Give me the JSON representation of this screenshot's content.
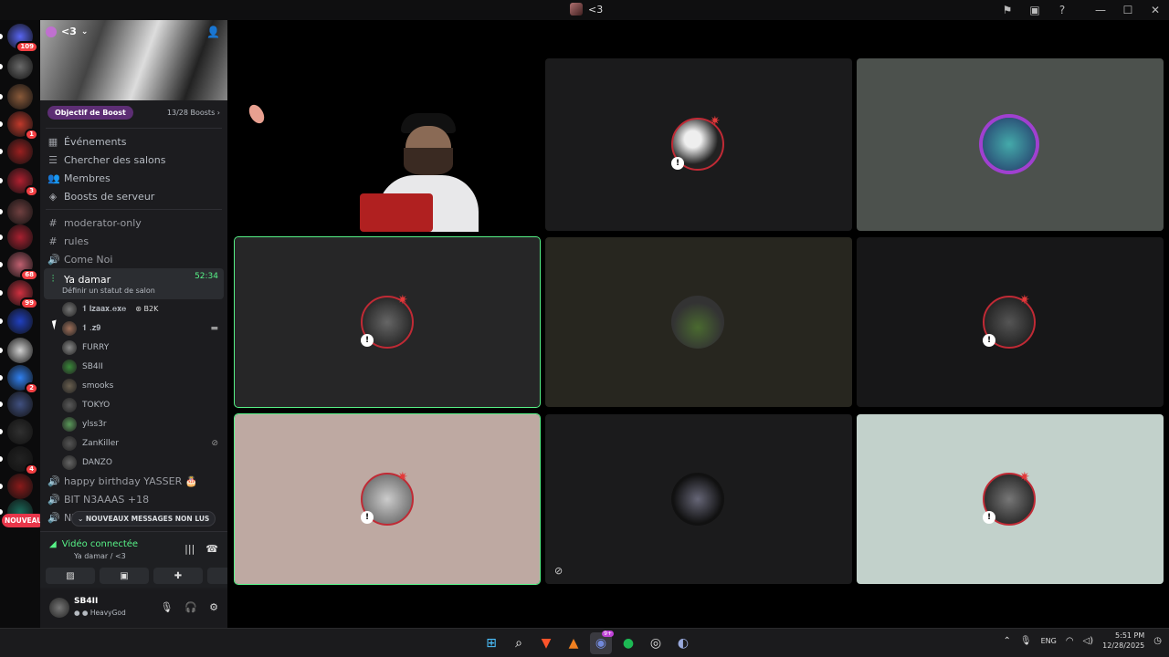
{
  "window": {
    "title": "<3"
  },
  "title_icons": [
    "inbox-icon",
    "screen-icon",
    "help-icon",
    "minimize-icon",
    "maximize-icon",
    "close-icon"
  ],
  "guilds": [
    {
      "name": "discord-home",
      "badge": "109",
      "color": "#5865f2"
    },
    {
      "name": "guild-1",
      "badge": "",
      "color": "#6a6a6a"
    },
    {
      "name": "guild-2",
      "badge": "",
      "color": "#8a5a3a"
    },
    {
      "name": "guild-3",
      "badge": "1",
      "color": "#c0392b"
    },
    {
      "name": "guild-4",
      "badge": "",
      "color": "#9a2020"
    },
    {
      "name": "guild-5",
      "badge": "3",
      "color": "#b02030"
    },
    {
      "name": "guild-6",
      "badge": "",
      "color": "#704040"
    },
    {
      "name": "guild-7",
      "badge": "",
      "color": "#a82030"
    },
    {
      "name": "guild-8",
      "badge": "68",
      "color": "#c06070"
    },
    {
      "name": "guild-9",
      "badge": "99",
      "color": "#d03040"
    },
    {
      "name": "guild-10",
      "badge": "",
      "color": "#2040c0"
    },
    {
      "name": "guild-11",
      "badge": "",
      "color": "#d0d0d0"
    },
    {
      "name": "guild-12",
      "badge": "2",
      "color": "#3080f0"
    },
    {
      "name": "guild-13",
      "badge": "",
      "color": "#405080"
    },
    {
      "name": "guild-14",
      "badge": "",
      "color": "#303030"
    },
    {
      "name": "guild-15",
      "badge": "4",
      "color": "#222"
    },
    {
      "name": "guild-16",
      "badge": "",
      "color": "#8a1a1a"
    },
    {
      "name": "guild-17",
      "badge": "",
      "color": "#1a6a5a"
    }
  ],
  "nouveau_label": "NOUVEAU",
  "server": {
    "name": "<3",
    "boost_goal": "Objectif de Boost",
    "boost_count": "13/28 Boosts",
    "nav": [
      {
        "label": "Événements",
        "icon": "calendar-icon",
        "glyph": "▦"
      },
      {
        "label": "Chercher des salons",
        "icon": "channel-browse-icon",
        "glyph": "☰"
      },
      {
        "label": "Membres",
        "icon": "members-icon",
        "glyph": "👥"
      },
      {
        "label": "Boosts de serveur",
        "icon": "boost-icon",
        "glyph": "◈"
      }
    ],
    "channels": [
      {
        "label": "moderator-only",
        "glyph": "#"
      },
      {
        "label": "rules",
        "glyph": "#"
      },
      {
        "label": "Come Noi",
        "glyph": "🔊"
      }
    ],
    "active_channel": {
      "label": "Ya damar",
      "timer": "52:34",
      "status": "Définir un statut de salon"
    },
    "voice_users": [
      {
        "name": "𝟏 𝐥𝐳𝐚𝐚𝐱.𝐞𝐱𝐞",
        "tag": "B2K",
        "right": ""
      },
      {
        "name": "𝟏 .𝐳𝟗",
        "tag": "",
        "right": "▬"
      },
      {
        "name": "FURRY",
        "tag": "",
        "right": ""
      },
      {
        "name": "SB4II",
        "tag": "",
        "right": ""
      },
      {
        "name": "smooks",
        "tag": "",
        "right": ""
      },
      {
        "name": "TOKYO",
        "tag": "",
        "right": ""
      },
      {
        "name": "ylss3r",
        "tag": "",
        "right": ""
      },
      {
        "name": "ZanKiller",
        "tag": "",
        "right": "⊘"
      },
      {
        "name": "DANZO",
        "tag": "",
        "right": ""
      }
    ],
    "more_channels": [
      {
        "label": "happy birthday YASSER 🎂"
      },
      {
        "label": "BIT N3AAAS +18"
      },
      {
        "label": "NEW LIFE 5 SMILE ;)"
      }
    ],
    "unread_label": "NOUVEAUX MESSAGES NON LUS"
  },
  "voice_panel": {
    "title": "Vidéo connectée",
    "subtitle": "Ya damar / <3"
  },
  "user": {
    "name": "SB4II",
    "status": "HeavyGod"
  },
  "taskbar": {
    "apps": [
      "windows-start-icon",
      "search-icon",
      "brave-icon",
      "app-icon",
      "discord-icon",
      "spotify-icon",
      "chrome-icon",
      "steam-icon"
    ],
    "discord_badge": "9+",
    "lang": "ENG",
    "time": "5:51 PM",
    "date": "12/28/2025"
  },
  "colors": {
    "accent": "#57f287",
    "danger": "#f23f43",
    "boost": "#5d2e74"
  }
}
